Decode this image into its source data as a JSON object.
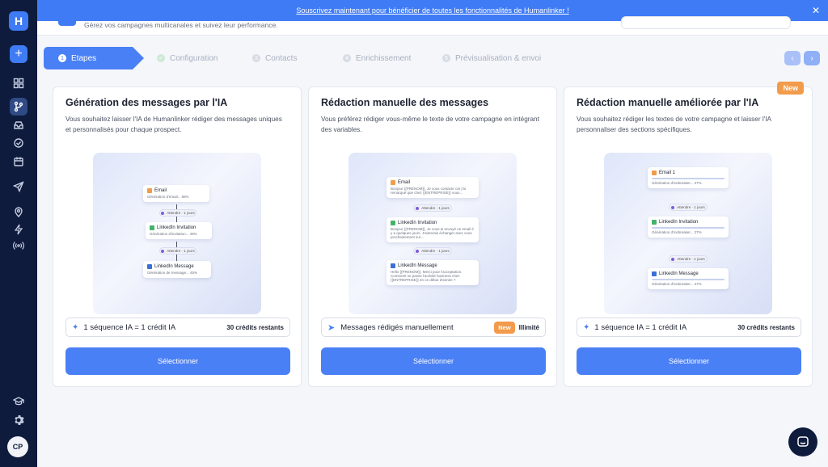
{
  "sidebar": {
    "logo": "H",
    "avatar_initials": "CP",
    "icons": [
      "plus-icon",
      "grid-icon",
      "branch-icon",
      "inbox-icon",
      "check-circle-icon",
      "calendar-icon",
      "send-icon",
      "map-pin-icon",
      "bolt-icon",
      "broadcast-icon",
      "graduation-cap-icon",
      "gear-icon"
    ]
  },
  "banner": {
    "link_text": "Souscrivez maintenant pour bénéficier de toutes les fonctionnalités de Humanlinker !",
    "close": "✕"
  },
  "header": {
    "subtitle": "Gérez vos campagnes multicanales et suivez leur performance."
  },
  "steps": [
    {
      "num": "1",
      "label": "Etapes"
    },
    {
      "num": "✓",
      "label": "Configuration"
    },
    {
      "num": "3",
      "label": "Contacts"
    },
    {
      "num": "4",
      "label": "Enrichissement"
    },
    {
      "num": "5",
      "label": "Prévisualisation & envoi"
    }
  ],
  "nav": {
    "prev": "‹",
    "next": "›"
  },
  "cards": [
    {
      "title": "Génération des messages par l'IA",
      "desc": "Vous souhaitez laisser l'IA de Humanlinker rédiger des messages uniques et personnalisés pour chaque prospect.",
      "info": "1 séquence IA = 1 crédit IA",
      "credits": "30 crédits restants",
      "button": "Sélectionner",
      "illus": {
        "step1": "Email",
        "step1_sub": "Génération d'email... 68%",
        "wait1": "Attendre · 1 jours",
        "step2": "LinkedIn Invitation",
        "step2_sub": "Génération d'invitation... 49%",
        "wait2": "Attendre · 1 jours",
        "step3": "LinkedIn Message",
        "step3_sub": "Génération de message... 45%"
      }
    },
    {
      "title": "Rédaction manuelle des messages",
      "desc": "Vous préférez rédiger vous-même le texte de votre campagne en intégrant des variables.",
      "info": "Messages rédigés manuellement",
      "badge_new": "New",
      "limit": "Illimité",
      "button": "Sélectionner",
      "illus": {
        "step1": "Email",
        "step1_sub": "Bonjour {{PRENOM}}, Je vous contacte car j'ai remarqué que chez {{ENTREPRISE}} vous...",
        "wait1": "Attendre · 1 jours",
        "step2": "LinkedIn Invitation",
        "step2_sub": "Bonjour {{PRENOM}}, Je vous ai envoyé un email il y a quelques jours. J'aimerais échanger avec vous prochainement sur...",
        "wait2": "Attendre · 1 jours",
        "step3": "LinkedIn Message",
        "step3_sub": "Hello {{PRENOM}}, Merci pour l'acceptation. Comment se passe l'activité business chez {{ENTREPRISE}} en ce début d'année ?"
      }
    },
    {
      "title": "Rédaction manuelle améliorée par l'IA",
      "desc": "Vous souhaitez rédiger les textes de votre campagne et laisser l'IA personnaliser des sections spécifiques.",
      "badge": "New",
      "info": "1 séquence IA = 1 crédit IA",
      "credits": "30 crédits restants",
      "button": "Sélectionner",
      "illus": {
        "step1": "Email 1",
        "step1_sub": "Génération d'icebreaker... 27%",
        "wait1": "Attendre · 1 jours",
        "step2": "LinkedIn Invitation",
        "step2_sub": "Génération d'icebreaker... 27%",
        "wait2": "Attendre · 1 jours",
        "step3": "LinkedIn Message",
        "step3_sub": "Génération d'icebreaker... 27%"
      }
    }
  ]
}
